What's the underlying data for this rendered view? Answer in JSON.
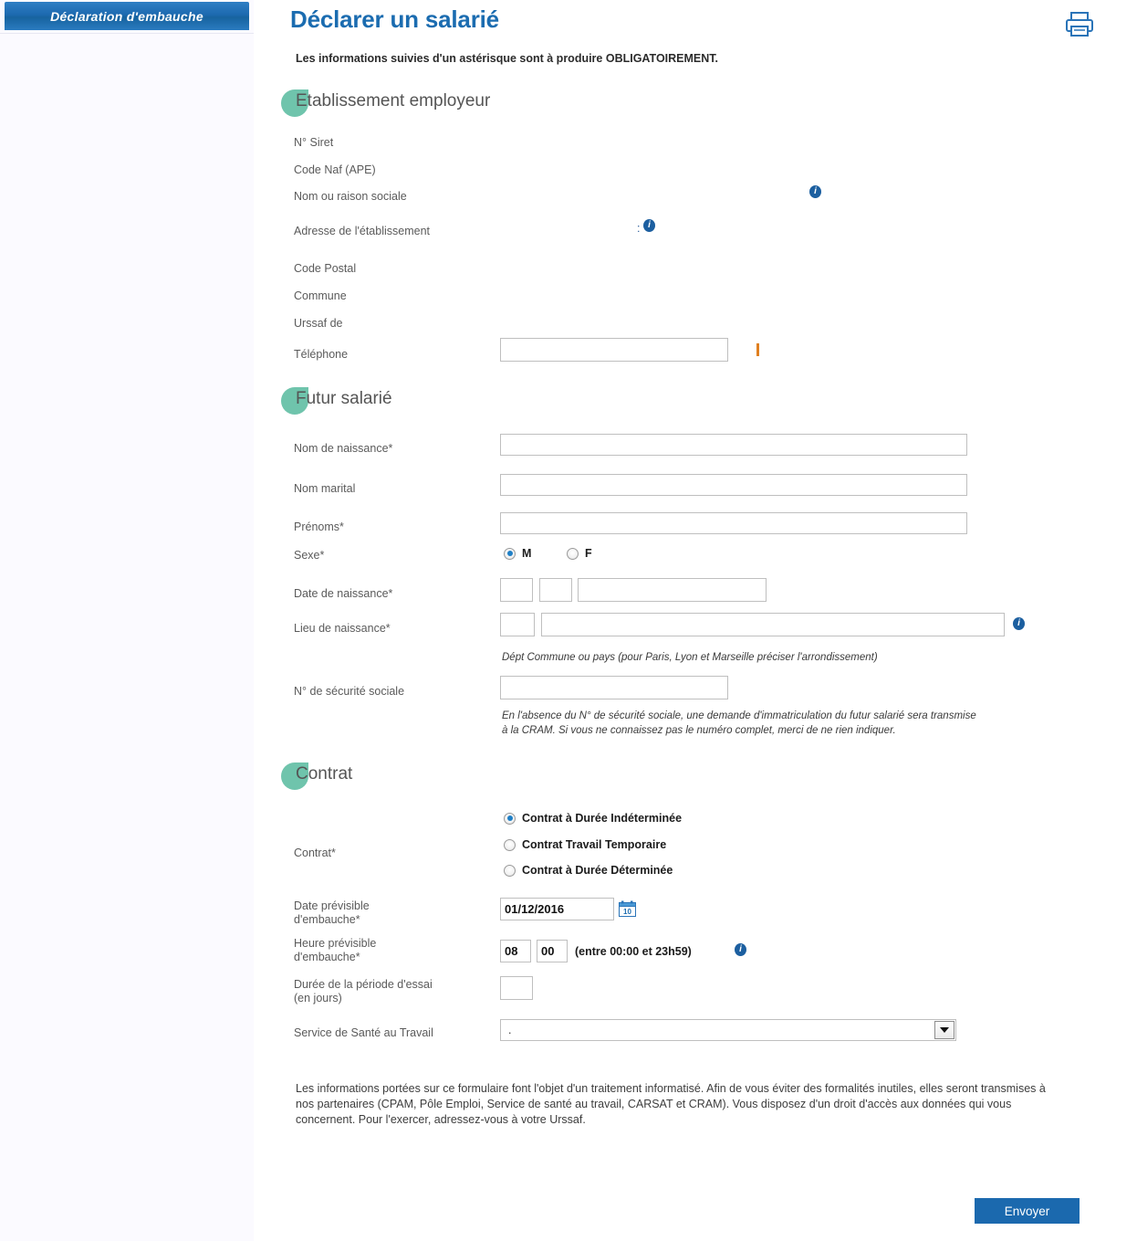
{
  "sidebar": {
    "tab_label": "Déclaration d'embauche"
  },
  "header": {
    "title": "Déclarer un salarié",
    "subtitle": "Les informations suivies d'un astérisque sont à produire OBLIGATOIREMENT.",
    "print_icon": "printer-icon"
  },
  "sections": {
    "employer": {
      "title": "Etablissement employeur"
    },
    "employee": {
      "title": "Futur salarié"
    },
    "contract": {
      "title": "Contrat"
    }
  },
  "employer_fields": {
    "siret_label": "N° Siret",
    "siret_value": "",
    "naf_label": "Code Naf (APE)",
    "naf_value": "",
    "name_label": "Nom ou raison sociale",
    "name_value": "",
    "address_label": "Adresse de l'établissement",
    "address_value": ":",
    "postal_label": "Code Postal",
    "postal_value": "",
    "commune_label": "Commune",
    "commune_value": "",
    "urssaf_label": "Urssaf de",
    "urssaf_value": "",
    "phone_label": "Téléphone",
    "phone_value": ""
  },
  "employee_fields": {
    "birth_name_label": "Nom de naissance*",
    "birth_name_value": "",
    "marital_name_label": "Nom marital",
    "marital_name_value": "",
    "firstnames_label": "Prénoms*",
    "firstnames_value": "",
    "sex_label": "Sexe*",
    "sex_options": [
      {
        "label": "M",
        "selected": true
      },
      {
        "label": "F",
        "selected": false
      }
    ],
    "birth_date_label": "Date de naissance*",
    "birth_date_day": "",
    "birth_date_month": "",
    "birth_date_year": "",
    "birth_place_label": "Lieu de naissance*",
    "birth_place_dept": "",
    "birth_place_commune": "",
    "birth_place_hint": "Dépt   Commune ou pays (pour Paris, Lyon et Marseille préciser l'arrondissement)",
    "ssn_label": "N° de sécurité sociale",
    "ssn_value": "",
    "ssn_hint_line1": "En l'absence du N° de sécurité sociale, une demande d'immatriculation du futur salarié sera transmise",
    "ssn_hint_line2": "à la CRAM. Si vous ne connaissez pas le numéro complet, merci de ne rien indiquer."
  },
  "contract_fields": {
    "contract_label": "Contrat*",
    "contract_options": [
      {
        "label": "Contrat à Durée Indéterminée",
        "selected": true
      },
      {
        "label": "Contrat Travail Temporaire",
        "selected": false
      },
      {
        "label": "Contrat à Durée Déterminée",
        "selected": false
      }
    ],
    "hire_date_label_line1": "Date prévisible",
    "hire_date_label_line2": "d'embauche*",
    "hire_date_value": "01/12/2016",
    "hire_time_label_line1": "Heure prévisible",
    "hire_time_label_line2": "d'embauche*",
    "hire_time_hour": "08",
    "hire_time_minute": "00",
    "hire_time_hint": "(entre 00:00 et 23h59)",
    "trial_label_line1": "Durée de la période d'essai",
    "trial_label_line2": "(en jours)",
    "trial_value": "",
    "health_service_label": "Service de Santé au Travail",
    "health_service_value": "."
  },
  "footer": {
    "legal_text": "Les informations portées sur ce formulaire font l'objet d'un traitement informatisé. Afin de vous éviter des formalités inutiles, elles seront transmises à nos partenaires (CPAM, Pôle Emploi, Service de santé au travail, CARSAT et CRAM). Vous disposez d'un droit d'accès aux données qui vous concernent. Pour l'exercer, adressez-vous à votre Urssaf.",
    "submit_label": "Envoyer"
  },
  "colors": {
    "title_blue": "#1b6cb0",
    "tab_blue": "#1d6ab0",
    "section_blob_teal": "#6fc4ac",
    "info_blue": "#1c5fa0",
    "submit_blue": "#1b69ae",
    "sidebar_bg": "#fbfaff"
  }
}
